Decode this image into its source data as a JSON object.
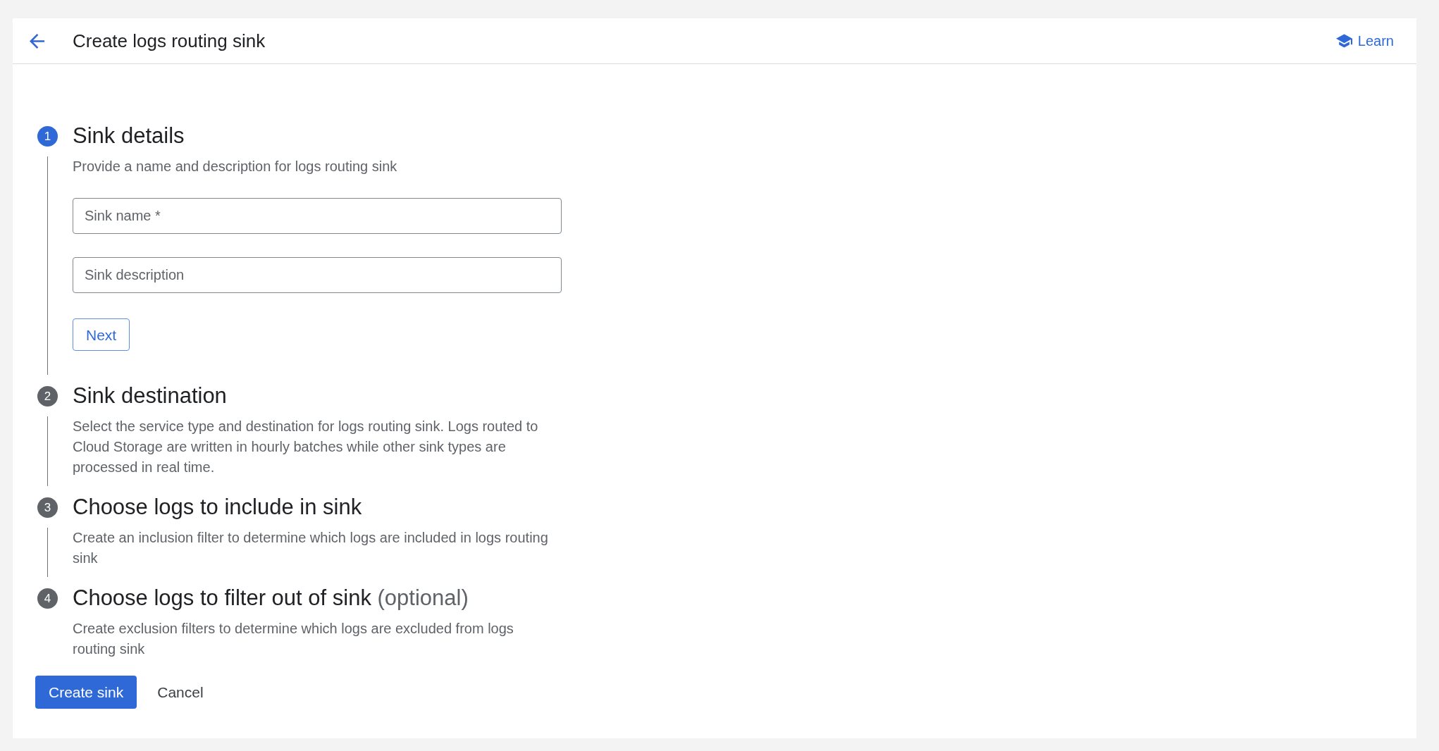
{
  "header": {
    "title": "Create logs routing sink",
    "learn_link": "Learn"
  },
  "steps": [
    {
      "number": "1",
      "title": "Sink details",
      "active": true,
      "description": "Provide a name and description for logs routing sink",
      "fields": [
        {
          "placeholder": "Sink name *"
        },
        {
          "placeholder": "Sink description"
        }
      ],
      "next_button": "Next"
    },
    {
      "number": "2",
      "title": "Sink destination",
      "active": false,
      "description": "Select the service type and destination for logs routing sink. Logs routed to Cloud Storage are written in hourly batches while other sink types are processed in real time."
    },
    {
      "number": "3",
      "title": "Choose logs to include in sink",
      "active": false,
      "description": "Create an inclusion filter to determine which logs are included in logs routing sink"
    },
    {
      "number": "4",
      "title": "Choose logs to filter out of sink",
      "note": "(optional)",
      "active": false,
      "description": "Create exclusion filters to determine which logs are excluded from logs routing sink"
    }
  ],
  "actions": {
    "create_button": "Create sink",
    "cancel_button": "Cancel"
  }
}
